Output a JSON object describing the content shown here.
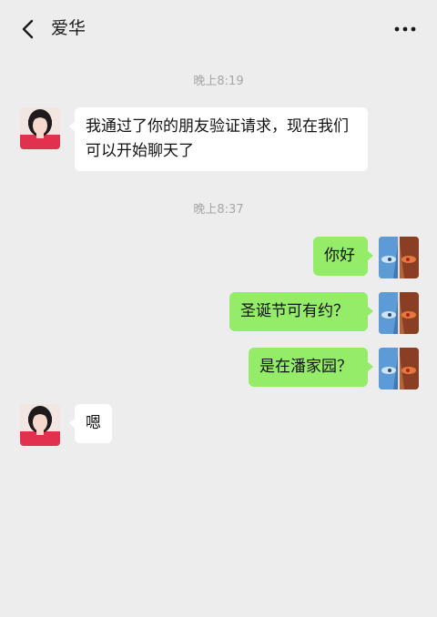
{
  "header": {
    "title": "爱华",
    "back_icon": "chevron-left-icon",
    "more_icon": "more-dots-icon"
  },
  "messages": {
    "time_1": "晚上8:19",
    "msg_1": "我通过了你的朋友验证请求，现在我们可以开始聊天了",
    "time_2": "晚上8:37",
    "msg_2": "你好",
    "msg_3": "圣诞节可有约？",
    "msg_4": "是在潘家园？",
    "msg_5": "嗯"
  },
  "colors": {
    "background": "#ededed",
    "incoming_bubble": "#ffffff",
    "outgoing_bubble": "#95ec69",
    "timestamp": "#a6a6a6"
  }
}
